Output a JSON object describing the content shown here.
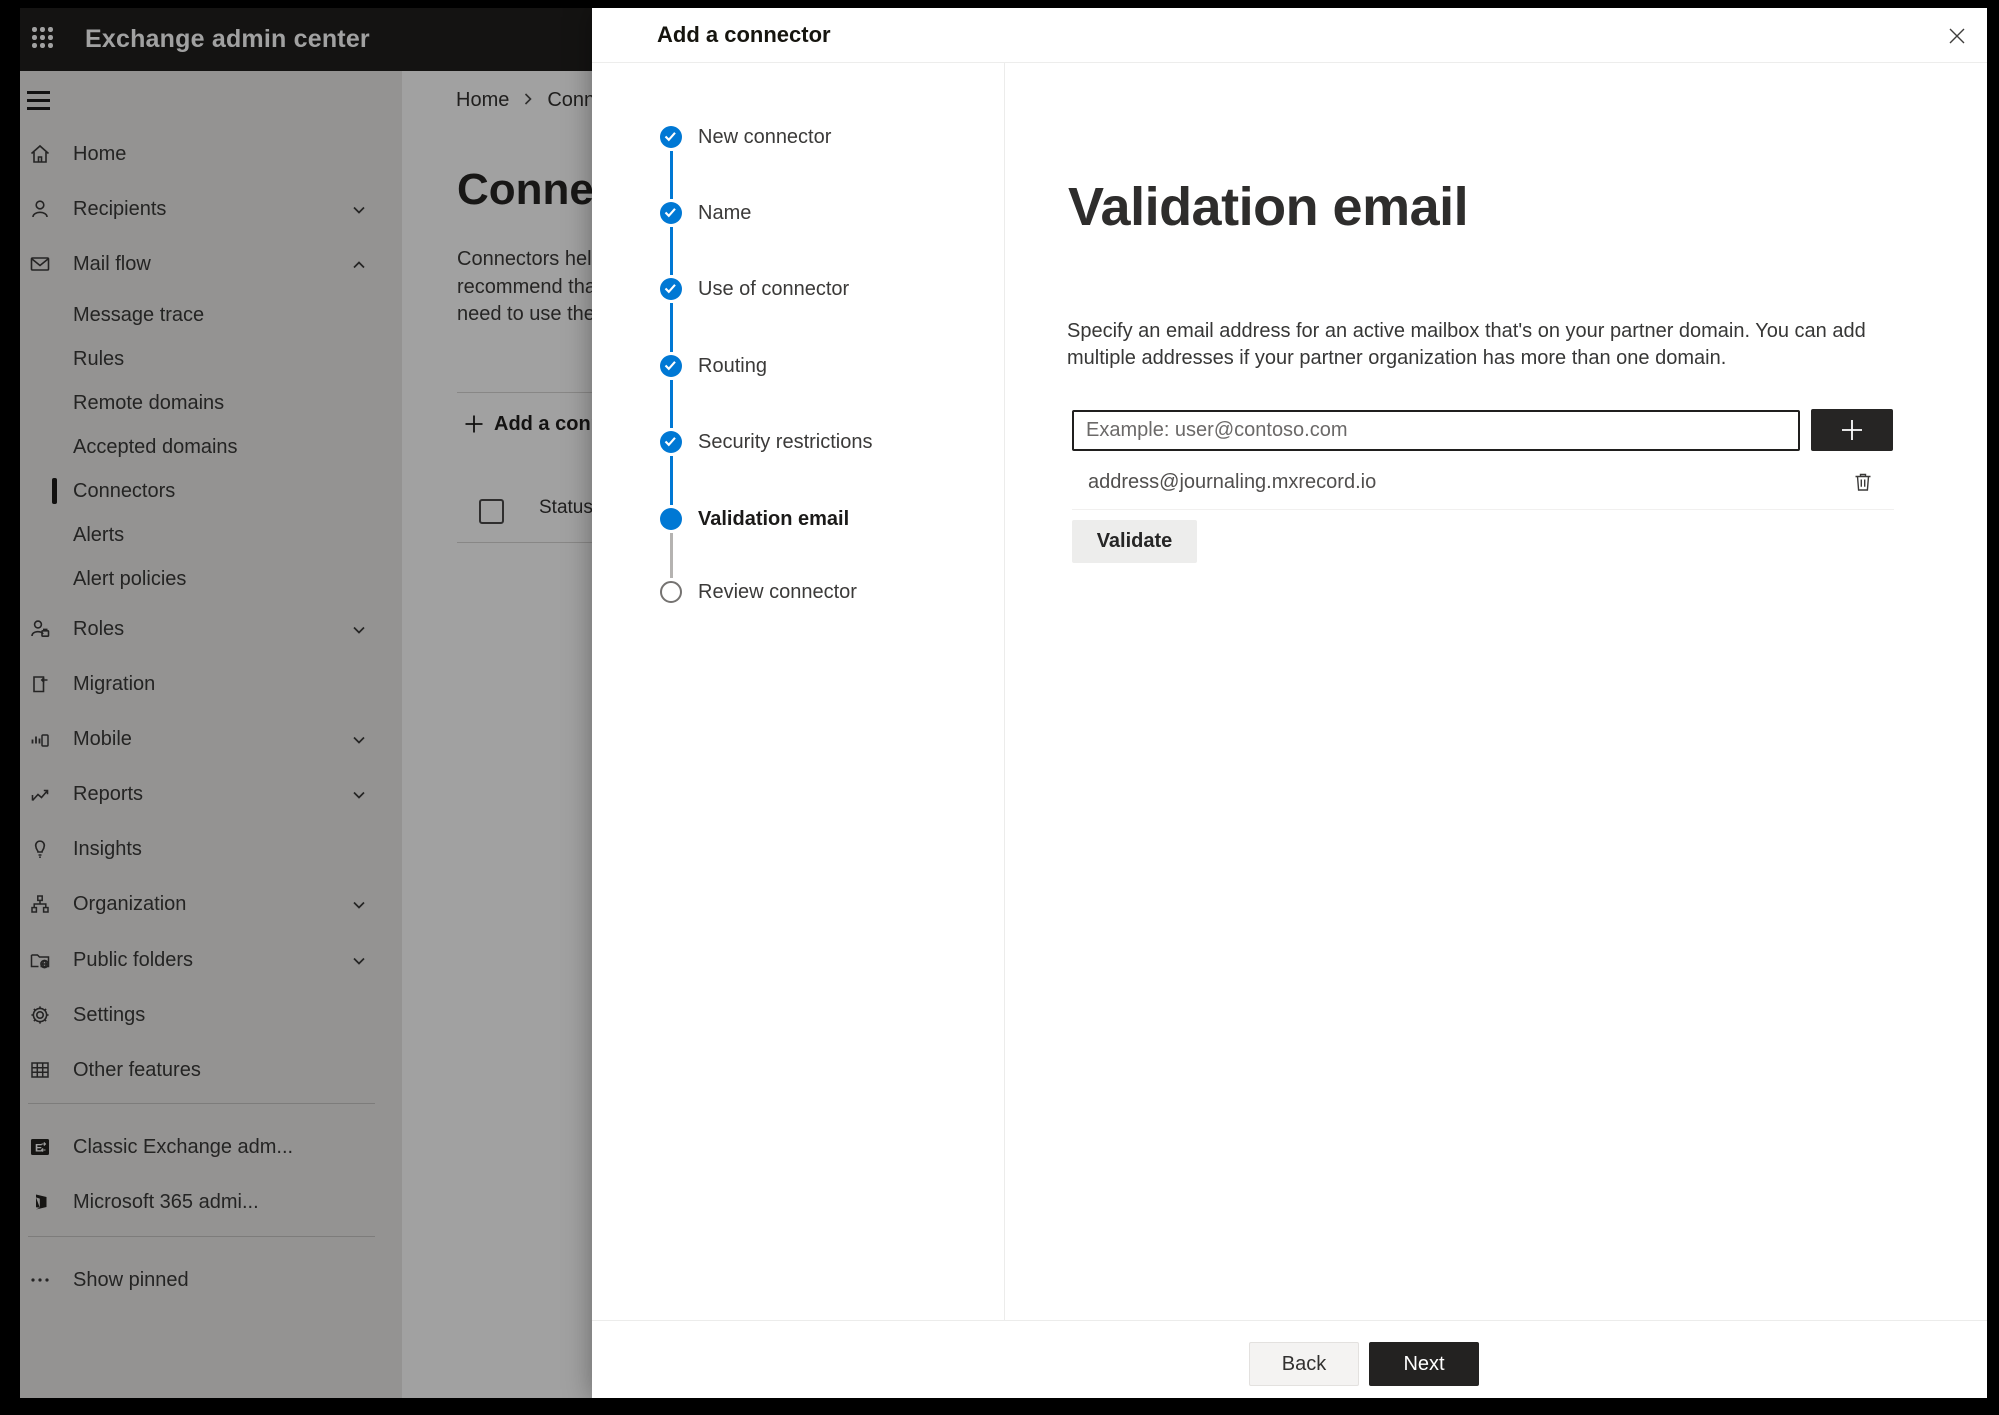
{
  "app": {
    "title": "Exchange admin center"
  },
  "sidebar": {
    "items": [
      {
        "label": "Home",
        "icon": "home-icon"
      },
      {
        "label": "Recipients",
        "icon": "people-icon",
        "chevron": "down"
      },
      {
        "label": "Mail flow",
        "icon": "mail-icon",
        "chevron": "up"
      },
      {
        "label": "Message trace",
        "sub": true
      },
      {
        "label": "Rules",
        "sub": true
      },
      {
        "label": "Remote domains",
        "sub": true
      },
      {
        "label": "Accepted domains",
        "sub": true
      },
      {
        "label": "Connectors",
        "sub": true,
        "selected": true
      },
      {
        "label": "Alerts",
        "sub": true
      },
      {
        "label": "Alert policies",
        "sub": true
      },
      {
        "label": "Roles",
        "icon": "roles-icon",
        "chevron": "down"
      },
      {
        "label": "Migration",
        "icon": "migration-icon"
      },
      {
        "label": "Mobile",
        "icon": "mobile-icon",
        "chevron": "down"
      },
      {
        "label": "Reports",
        "icon": "reports-icon",
        "chevron": "down"
      },
      {
        "label": "Insights",
        "icon": "insights-icon"
      },
      {
        "label": "Organization",
        "icon": "organization-icon",
        "chevron": "down"
      },
      {
        "label": "Public folders",
        "icon": "public-folders-icon",
        "chevron": "down"
      },
      {
        "label": "Settings",
        "icon": "settings-icon"
      },
      {
        "label": "Other features",
        "icon": "other-features-icon"
      },
      {
        "label": "Classic Exchange adm...",
        "icon": "classic-exchange-icon"
      },
      {
        "label": "Microsoft 365 admi...",
        "icon": "microsoft-365-icon"
      },
      {
        "label": "Show pinned",
        "icon": "ellipsis-icon"
      }
    ]
  },
  "page": {
    "breadcrumb": {
      "home": "Home",
      "current": "Conne"
    },
    "title": "Connect",
    "description_lines": [
      "Connectors help",
      "recommend that",
      "need to use ther"
    ],
    "add_button_label": "Add a conn",
    "table": {
      "status_header": "Status"
    }
  },
  "dialog": {
    "title": "Add a connector",
    "steps": [
      {
        "label": "New connector",
        "state": "done"
      },
      {
        "label": "Name",
        "state": "done"
      },
      {
        "label": "Use of connector",
        "state": "done"
      },
      {
        "label": "Routing",
        "state": "done"
      },
      {
        "label": "Security restrictions",
        "state": "done"
      },
      {
        "label": "Validation email",
        "state": "current"
      },
      {
        "label": "Review connector",
        "state": "upcoming"
      }
    ],
    "content": {
      "heading": "Validation email",
      "description_line1": "Specify an email address for an active mailbox that's on your partner domain. You can add",
      "description_line2": "multiple addresses if your partner organization has more than one domain.",
      "email_input": {
        "value": "",
        "placeholder": "Example: user@contoso.com"
      },
      "addresses": [
        {
          "email": "address@journaling.mxrecord.io"
        }
      ],
      "validate_button": "Validate"
    },
    "footer": {
      "back_button": "Back",
      "next_button": "Next"
    }
  },
  "colors": {
    "accent": "#0078d4",
    "primary_button_bg": "#232221",
    "header_bg": "#201f1e"
  }
}
